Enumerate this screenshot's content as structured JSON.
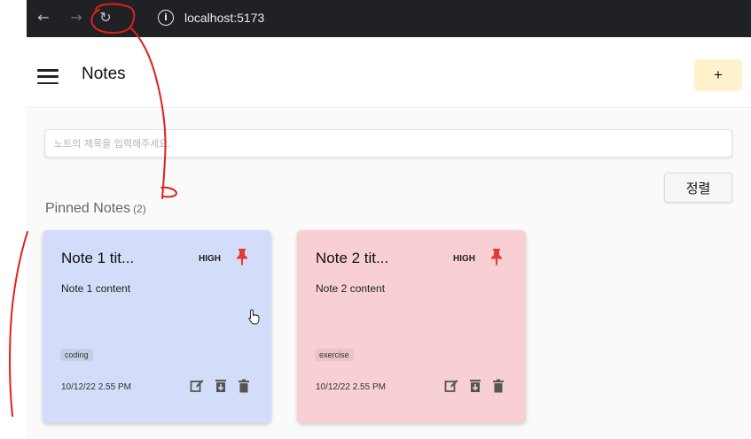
{
  "browser": {
    "url": "localhost:5173",
    "back_icon": "arrow-left-icon",
    "forward_icon": "arrow-right-icon",
    "reload_icon": "reload-icon",
    "info_icon": "info-icon"
  },
  "header": {
    "menu_icon": "hamburger-menu-icon",
    "title": "Notes",
    "add_label": "+"
  },
  "search": {
    "placeholder": "노트의 제목을 입력해주세요.",
    "value": ""
  },
  "sort": {
    "label": "정렬"
  },
  "pinned_section": {
    "title": "Pinned Notes",
    "count": "(2)"
  },
  "notes": [
    {
      "title": "Note 1 tit...",
      "priority": "HIGH",
      "content": "Note 1 content",
      "tag": "coding",
      "date": "10/12/22 2.55 PM",
      "background": "#d3dcf8",
      "tag_background": "#c6cee7"
    },
    {
      "title": "Note 2 tit...",
      "priority": "HIGH",
      "content": "Note 2 content",
      "tag": "exercise",
      "date": "10/12/22 2.55 PM",
      "background": "#f8cfd2",
      "tag_background": "#e9c3c6"
    }
  ],
  "colors": {
    "accent_add": "#fdf2cc",
    "pin": "#e53935",
    "annotation": "#e0201c",
    "browser_bar": "#202124"
  }
}
